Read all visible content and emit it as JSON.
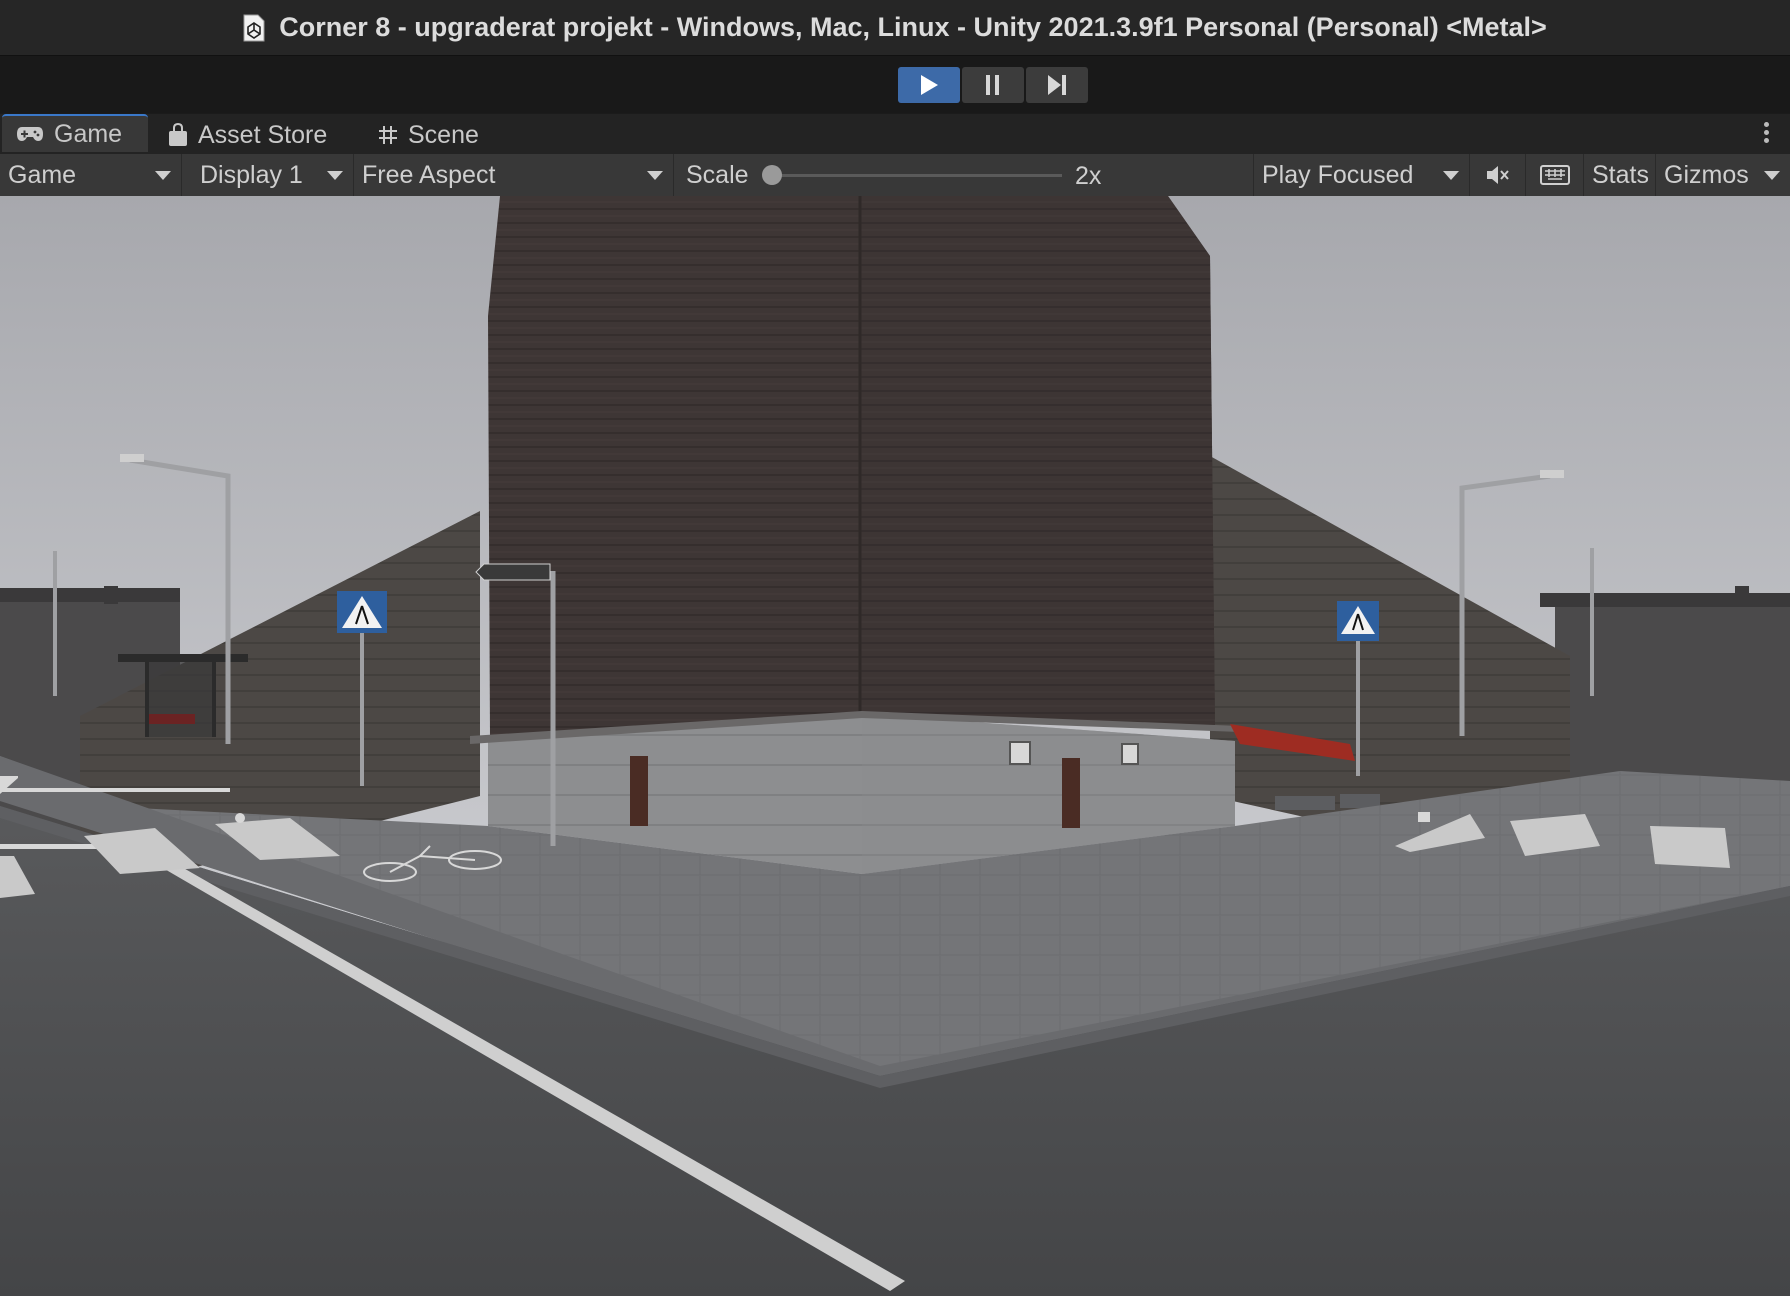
{
  "window": {
    "title": "Corner 8 - upgraderat projekt - Windows, Mac, Linux - Unity 2021.3.9f1 Personal (Personal) <Metal>"
  },
  "playback": {
    "play_icon": "play-icon",
    "pause_icon": "pause-icon",
    "step_icon": "step-icon",
    "play_active": true
  },
  "tabs": [
    {
      "label": "Game",
      "icon": "gamepad-icon",
      "active": true
    },
    {
      "label": "Asset Store",
      "icon": "shopping-bag-icon",
      "active": false
    },
    {
      "label": "Scene",
      "icon": "grid-icon",
      "active": false
    }
  ],
  "game_view": {
    "view_select": "Game",
    "display_select": "Display 1",
    "aspect_select": "Free Aspect",
    "scale_label": "Scale",
    "scale_value": "2x",
    "play_mode_select": "Play Focused",
    "mute_icon": "mute-audio-icon",
    "keyboard_icon": "keyboard-icon",
    "stats_label": "Stats",
    "gizmos_label": "Gizmos"
  },
  "colors": {
    "accent": "#3d6aa8",
    "tab_highlight": "#3a78c9"
  }
}
